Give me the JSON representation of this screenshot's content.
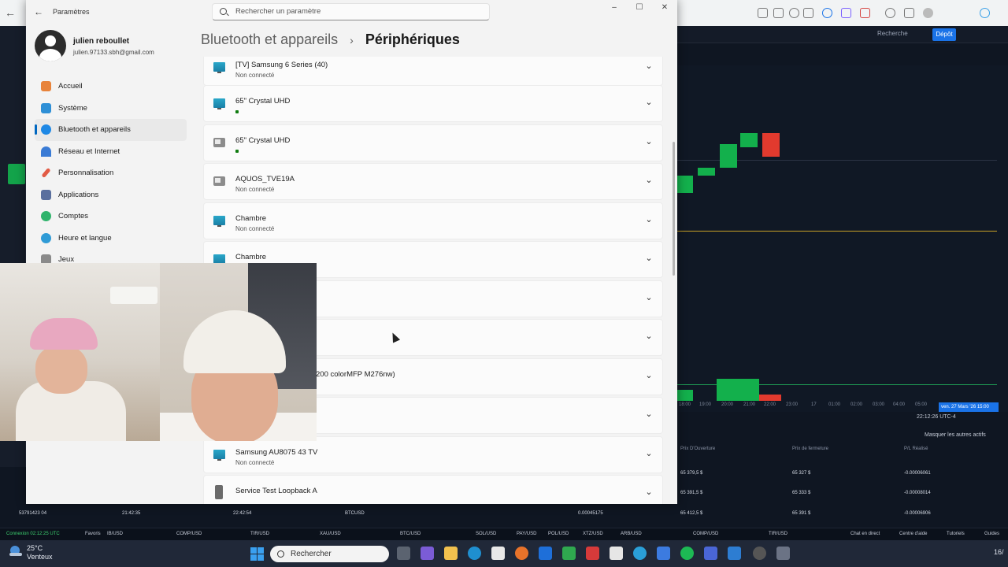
{
  "settings": {
    "app_title": "Paramètres",
    "search_placeholder": "Rechercher un paramètre",
    "user": {
      "name": "julien reboullet",
      "email": "julien.97133.sbh@gmail.com"
    },
    "nav": [
      {
        "label": "Accueil",
        "icon": "home-icon",
        "color": "#e8833a"
      },
      {
        "label": "Système",
        "icon": "system-icon",
        "color": "#2e8fd6"
      },
      {
        "label": "Bluetooth et appareils",
        "icon": "bluetooth-icon",
        "color": "#1e88e5",
        "active": true
      },
      {
        "label": "Réseau et Internet",
        "icon": "wifi-icon",
        "color": "#3a7bd5"
      },
      {
        "label": "Personnalisation",
        "icon": "brush-icon",
        "color": "#e25b45"
      },
      {
        "label": "Applications",
        "icon": "apps-icon",
        "color": "#5a6f9e"
      },
      {
        "label": "Comptes",
        "icon": "accounts-icon",
        "color": "#2fb36b"
      },
      {
        "label": "Heure et langue",
        "icon": "globe-clock-icon",
        "color": "#2f9bd6"
      },
      {
        "label": "Jeux",
        "icon": "gaming-icon",
        "color": "#8a8a8a"
      }
    ],
    "breadcrumb": {
      "parent": "Bluetooth et appareils",
      "separator": "›",
      "current": "Périphériques"
    },
    "devices": [
      {
        "name": "[TV] Samsung 6 Series (40)",
        "status": "Non connecté",
        "icon": "monitor-icon"
      },
      {
        "name": "65\" Crystal UHD",
        "status": "",
        "icon": "monitor-icon",
        "dot": true
      },
      {
        "name": "65\" Crystal UHD",
        "status": "",
        "icon": "media-device-icon",
        "dot": true
      },
      {
        "name": "AQUOS_TVE19A",
        "status": "Non connecté",
        "icon": "media-device-icon"
      },
      {
        "name": "Chambre",
        "status": "Non connecté",
        "icon": "monitor-icon"
      },
      {
        "name": "Chambre",
        "status": "",
        "icon": "monitor-icon"
      },
      {
        "name": "",
        "status": "",
        "icon": ""
      },
      {
        "name": "",
        "status": "",
        "icon": ""
      },
      {
        "name": "200 colorMFP M276nw)",
        "status": "",
        "icon": ""
      },
      {
        "name": "",
        "status": "",
        "icon": ""
      },
      {
        "name": "Samsung AU8075 43 TV",
        "status": "Non connecté",
        "icon": "monitor-icon"
      },
      {
        "name": "Service Test Loopback A",
        "status": "",
        "icon": "speaker-icon",
        "dot": true
      }
    ]
  },
  "trading": {
    "search_label": "Recherche",
    "deposit_label": "Dépôt",
    "time_labels": [
      "18:00",
      "19:00",
      "20:00",
      "21:00",
      "22:00",
      "23:00",
      "17",
      "01:00",
      "02:00",
      "03:00",
      "04:00",
      "05:00"
    ],
    "current_time_tag": "ven. 27 Mars '26   15:00",
    "clock": "22:12:26 UTC-4",
    "masquer": "Masquer les autres actifs",
    "table_headers": [
      "Prix D'Ouverture",
      "Prix de fermeture",
      "P/L Réalisé"
    ],
    "rows": [
      {
        "open": "65 379,5 $",
        "close": "65 327 $",
        "pl": "-0.00006061"
      },
      {
        "open": "65 391,5 $",
        "close": "65 333 $",
        "pl": "-0.00008014"
      },
      {
        "open": "65 412,5 $",
        "close": "65 391 $",
        "pl": "-0.00006906"
      }
    ],
    "bottom_row": {
      "id": "53791423 04",
      "time1": "21:42:35",
      "time2": "22:42:54",
      "asset": "BTCUSD",
      "amount": "0.00045175"
    },
    "ticker": [
      "Connexion 02:12:25 UTC",
      "Favoris",
      "IB/USD",
      "COMP/USD",
      "TIR/USD",
      "XAU/USD",
      "BTC/USD",
      "SOL/USD",
      "PAY/USD",
      "POL/USD",
      "XTZ/USD",
      "ARB/USD",
      "COMP/USD",
      "TIR/USD",
      "Chat en direct",
      "Centre d'aide",
      "Tutoriels",
      "Guides"
    ]
  },
  "taskbar": {
    "temperature": "25°C",
    "weather": "Venteux",
    "search_placeholder": "Rechercher",
    "tray_time": "16/"
  }
}
